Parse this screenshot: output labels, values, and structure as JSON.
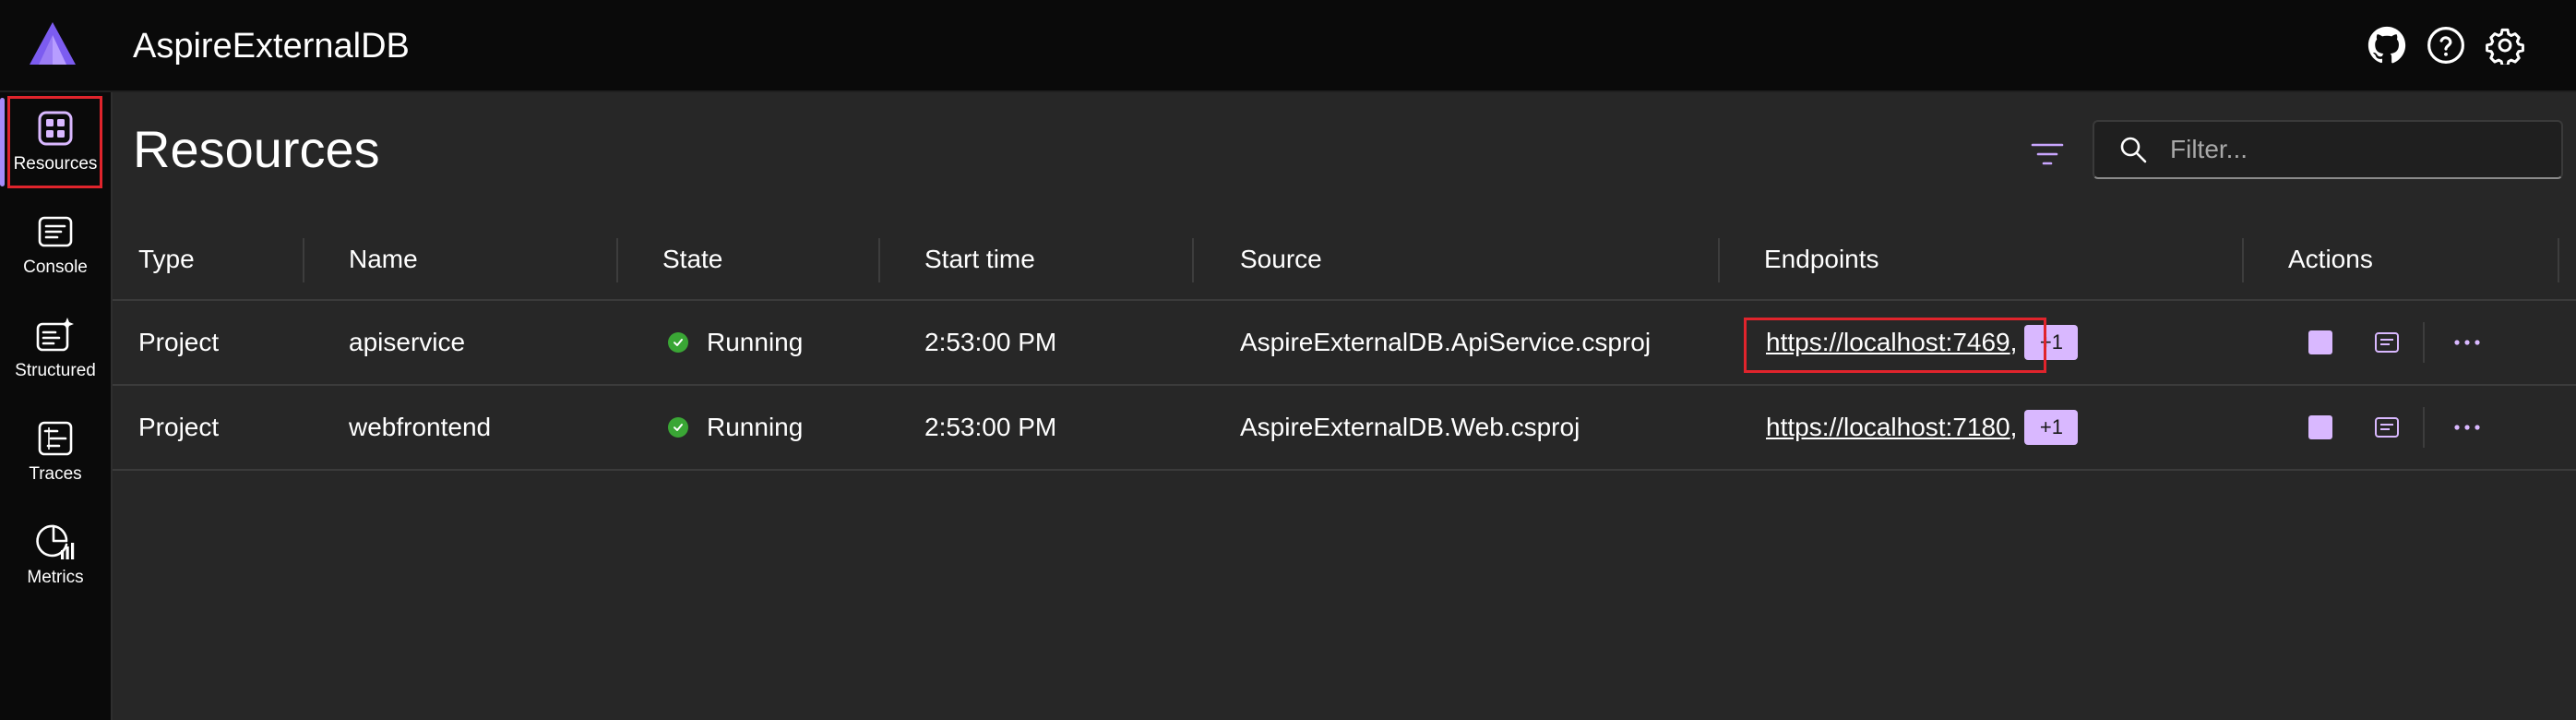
{
  "app": {
    "title": "AspireExternalDB"
  },
  "header_icons": [
    "github-icon",
    "help-icon",
    "settings-icon"
  ],
  "nav": [
    {
      "label": "Resources",
      "icon": "resources-icon",
      "active": true
    },
    {
      "label": "Console",
      "icon": "console-icon"
    },
    {
      "label": "Structured",
      "icon": "structured-icon"
    },
    {
      "label": "Traces",
      "icon": "traces-icon"
    },
    {
      "label": "Metrics",
      "icon": "metrics-icon"
    }
  ],
  "page": {
    "title": "Resources"
  },
  "search": {
    "placeholder": "Filter...",
    "value": ""
  },
  "table": {
    "columns": [
      "Type",
      "Name",
      "State",
      "Start time",
      "Source",
      "Endpoints",
      "Actions"
    ],
    "rows": [
      {
        "type": "Project",
        "name": "apiservice",
        "state": "Running",
        "start_time": "2:53:00 PM",
        "source": "AspireExternalDB.ApiService.csproj",
        "endpoint": "https://localhost:7469",
        "endpoint_suffix": ",",
        "more_endpoints": "+1"
      },
      {
        "type": "Project",
        "name": "webfrontend",
        "state": "Running",
        "start_time": "2:53:00 PM",
        "source": "AspireExternalDB.Web.csproj",
        "endpoint": "https://localhost:7180",
        "endpoint_suffix": ",",
        "more_endpoints": "+1"
      }
    ]
  },
  "colors": {
    "accent": "#d9b8ff",
    "brand_purple": "#a78bfa",
    "running_green": "#3aa635",
    "highlight_red": "#e0242c",
    "background": "#272727",
    "chrome": "#0a0a0a"
  }
}
